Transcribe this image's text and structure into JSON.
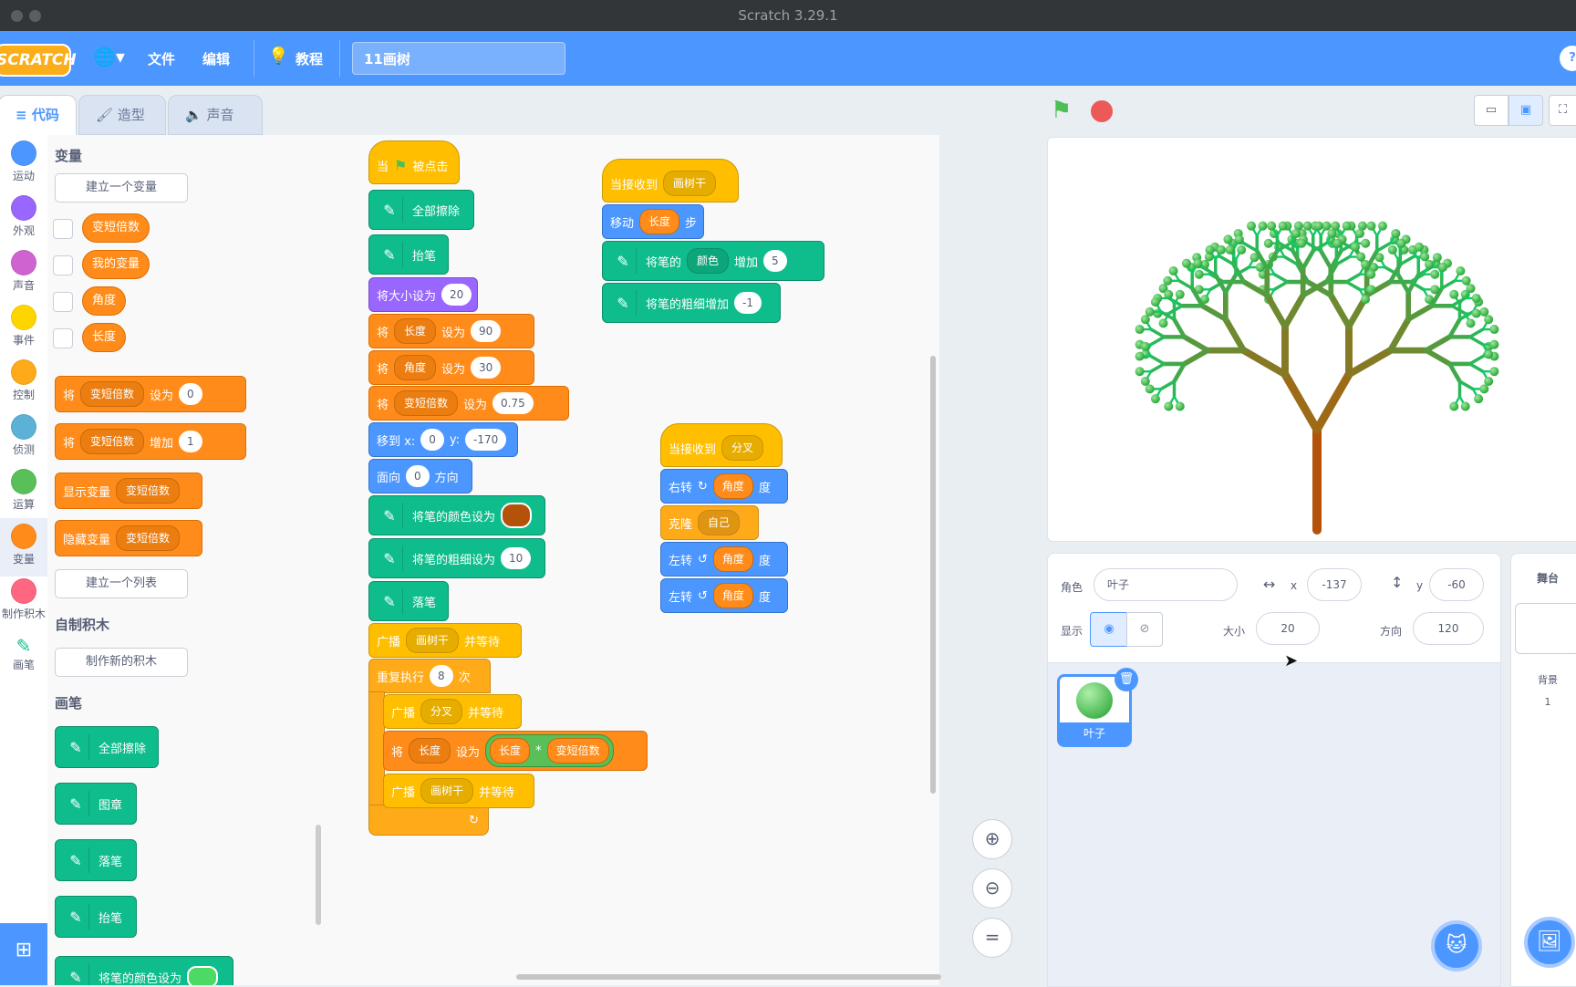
{
  "window": {
    "title": "Scratch 3.29.1"
  },
  "menu": {
    "logo": "SCRATCH",
    "file": "文件",
    "edit": "编辑",
    "tutorials": "教程",
    "project_name": "11画树"
  },
  "tabs": {
    "code": "代码",
    "costumes": "造型",
    "sounds": "声音"
  },
  "categories": [
    {
      "label": "运动",
      "color": "#4c97ff"
    },
    {
      "label": "外观",
      "color": "#9966ff"
    },
    {
      "label": "声音",
      "color": "#cf63cf"
    },
    {
      "label": "事件",
      "color": "#ffd500"
    },
    {
      "label": "控制",
      "color": "#ffab19"
    },
    {
      "label": "侦测",
      "color": "#5cb1d6"
    },
    {
      "label": "运算",
      "color": "#59c059"
    },
    {
      "label": "变量",
      "color": "#ff8c1a"
    },
    {
      "label": "制作积木",
      "color": "#ff6680"
    },
    {
      "label": "画笔",
      "color": "#0fbd8c"
    }
  ],
  "palette": {
    "variables_heading": "变量",
    "make_variable": "建立一个变量",
    "vars": [
      "变短倍数",
      "我的变量",
      "角度",
      "长度"
    ],
    "set_block": {
      "verb": "将",
      "var": "变短倍数",
      "op": "设为",
      "value": "0"
    },
    "change_block": {
      "verb": "将",
      "var": "变短倍数",
      "op": "增加",
      "value": "1"
    },
    "show_block": {
      "label": "显示变量",
      "var": "变短倍数"
    },
    "hide_block": {
      "label": "隐藏变量",
      "var": "变短倍数"
    },
    "make_list": "建立一个列表",
    "myblocks_heading": "自制积木",
    "make_block": "制作新的积木",
    "pen_heading": "画笔",
    "pen_blocks": [
      "全部擦除",
      "图章",
      "落笔",
      "抬笔",
      "将笔的颜色设为"
    ]
  },
  "script1": {
    "hat": {
      "when": "当",
      "clicked": "被点击"
    },
    "erase_all": "全部擦除",
    "pen_up": "抬笔",
    "set_size": {
      "label": "将大小设为",
      "value": "20"
    },
    "set_len": {
      "verb": "将",
      "var": "长度",
      "op": "设为",
      "value": "90"
    },
    "set_angle": {
      "verb": "将",
      "var": "角度",
      "op": "设为",
      "value": "30"
    },
    "set_ratio": {
      "verb": "将",
      "var": "变短倍数",
      "op": "设为",
      "value": "0.75"
    },
    "goto": {
      "label": "移到 x:",
      "x": "0",
      "ylabel": "y:",
      "y": "-170"
    },
    "point": {
      "label": "面向",
      "value": "0",
      "suffix": "方向"
    },
    "pen_color": {
      "label": "将笔的颜色设为",
      "color": "#b5520a"
    },
    "pen_size": {
      "label": "将笔的粗细设为",
      "value": "10"
    },
    "pen_down": "落笔",
    "broadcast1": {
      "label": "广播",
      "msg": "画树干",
      "suffix": "并等待"
    },
    "repeat": {
      "label": "重复执行",
      "value": "8",
      "suffix": "次"
    },
    "broadcast2": {
      "label": "广播",
      "msg": "分叉",
      "suffix": "并等待"
    },
    "set_len2": {
      "verb": "将",
      "var": "长度",
      "op": "设为",
      "a": "长度",
      "times": "*",
      "b": "变短倍数"
    },
    "broadcast3": {
      "label": "广播",
      "msg": "画树干",
      "suffix": "并等待"
    },
    "loop_arrow": "↻"
  },
  "script2": {
    "hat": {
      "label": "当接收到",
      "msg": "画树干"
    },
    "move": {
      "label": "移动",
      "var": "长度",
      "suffix": "步"
    },
    "change_color": {
      "label": "将笔的",
      "param": "颜色",
      "op": "增加",
      "value": "5"
    },
    "change_size": {
      "label": "将笔的粗细增加",
      "value": "-1"
    }
  },
  "script3": {
    "hat": {
      "label": "当接收到",
      "msg": "分叉"
    },
    "turn_right": {
      "label": "右转",
      "var": "角度",
      "suffix": "度"
    },
    "clone": {
      "label": "克隆",
      "target": "自己"
    },
    "turn_left1": {
      "label": "左转",
      "var": "角度",
      "suffix": "度"
    },
    "turn_left2": {
      "label": "左转",
      "var": "角度",
      "suffix": "度"
    }
  },
  "sprite_info": {
    "sprite_label": "角色",
    "sprite_name": "叶子",
    "x_label": "x",
    "x": "-137",
    "y_label": "y",
    "y": "-60",
    "show_label": "显示",
    "size_label": "大小",
    "size": "20",
    "direction_label": "方向",
    "direction": "120"
  },
  "sprites": [
    {
      "name": "叶子"
    }
  ],
  "stage_pane": {
    "title": "舞台",
    "backdrops_label": "背景",
    "backdrops_count": "1"
  }
}
